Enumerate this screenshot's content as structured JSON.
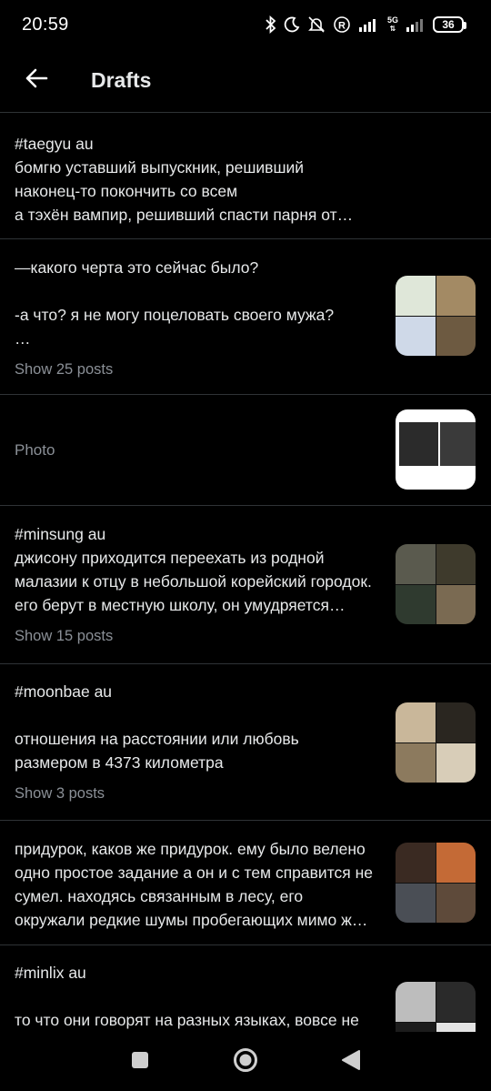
{
  "status_bar": {
    "time": "20:59",
    "network": "5G",
    "battery": "36"
  },
  "header": {
    "title": "Drafts"
  },
  "drafts": [
    {
      "text": "#taegyu au\nбомгю уставший выпускник, решивший наконец-то покончить со всем\nа тэхён вампир, решивший спасти парня от неминуемого…"
    },
    {
      "text": "—какого черта это сейчас было?\n\n-а что? я не могу поцеловать своего мужа?\n…",
      "show_posts": "Show 25 posts",
      "thumbnail": "chat-and-photo-collage"
    },
    {
      "text": "Photo",
      "thumbnail": "post-screenshot"
    },
    {
      "text": "#minsung au\nджисону приходится переехать из родной малазии к отцу в небольшой корейский городок. его берут в местную школу, он умудряется под…",
      "show_posts": "Show 15 posts",
      "thumbnail": "collage"
    },
    {
      "text": "#moonbae au\n\nотношения на расстоянии или любовь размером в 4373 километра",
      "show_posts": "Show 3 posts",
      "thumbnail": "collage"
    },
    {
      "text": "придурок, каков же придурок. ему было велено одно простое задание а он и с тем справится не сумел. находясь связанным в лесу, его окружали редкие шумы пробегающих мимо ж…",
      "thumbnail": "collage"
    },
    {
      "text": "#minlix au\n\nто что они говорят на разных языках, вовсе не",
      "thumbnail": "collage"
    }
  ],
  "icons": {
    "back": "arrow-left-icon",
    "nav_recents": "square-icon",
    "nav_home": "circle-icon",
    "nav_back": "triangle-icon"
  },
  "colors": {
    "background": "#000000",
    "text": "#e7e9ea",
    "muted": "#8b9097",
    "divider": "#2f3336"
  }
}
